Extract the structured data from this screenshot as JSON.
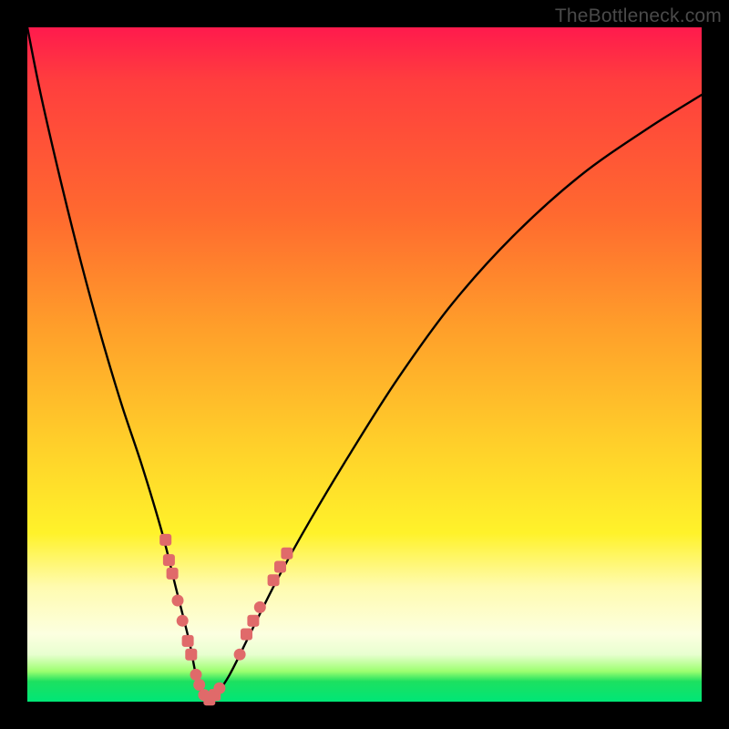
{
  "watermark": "TheBottleneck.com",
  "colors": {
    "frame": "#000000",
    "gradient_top": "#ff1a4d",
    "gradient_mid1": "#ff6a2f",
    "gradient_mid2": "#ffd02a",
    "gradient_mid3": "#fffbb0",
    "gradient_bottom": "#00e676",
    "curve": "#000000",
    "markers": "#e06a6a"
  },
  "chart_data": {
    "type": "line",
    "title": "",
    "xlabel": "",
    "ylabel": "",
    "xlim": [
      0,
      100
    ],
    "ylim": [
      0,
      100
    ],
    "grid": false,
    "legend": false,
    "series": [
      {
        "name": "bottleneck-curve",
        "x": [
          0,
          2,
          5,
          8,
          11,
          14,
          17,
          20,
          22,
          24,
          25,
          26,
          27,
          28,
          30,
          33,
          37,
          42,
          48,
          55,
          63,
          72,
          82,
          92,
          100
        ],
        "values": [
          100,
          90,
          77,
          65,
          54,
          44,
          35,
          25,
          17,
          9,
          4,
          1,
          0,
          1,
          4,
          10,
          18,
          27,
          37,
          48,
          59,
          69,
          78,
          85,
          90
        ]
      }
    ],
    "markers": [
      {
        "x": 20.5,
        "y": 24,
        "shape": "square"
      },
      {
        "x": 21.0,
        "y": 21,
        "shape": "square"
      },
      {
        "x": 21.5,
        "y": 19,
        "shape": "square"
      },
      {
        "x": 22.3,
        "y": 15,
        "shape": "circle"
      },
      {
        "x": 23.0,
        "y": 12,
        "shape": "circle"
      },
      {
        "x": 23.8,
        "y": 9,
        "shape": "square"
      },
      {
        "x": 24.3,
        "y": 7,
        "shape": "square"
      },
      {
        "x": 25.0,
        "y": 4,
        "shape": "circle"
      },
      {
        "x": 25.5,
        "y": 2.5,
        "shape": "circle"
      },
      {
        "x": 26.2,
        "y": 1,
        "shape": "circle"
      },
      {
        "x": 27.0,
        "y": 0.3,
        "shape": "square"
      },
      {
        "x": 27.8,
        "y": 1,
        "shape": "square"
      },
      {
        "x": 28.5,
        "y": 2,
        "shape": "circle"
      },
      {
        "x": 31.5,
        "y": 7,
        "shape": "circle"
      },
      {
        "x": 32.5,
        "y": 10,
        "shape": "square"
      },
      {
        "x": 33.5,
        "y": 12,
        "shape": "square"
      },
      {
        "x": 34.5,
        "y": 14,
        "shape": "circle"
      },
      {
        "x": 36.5,
        "y": 18,
        "shape": "square"
      },
      {
        "x": 37.5,
        "y": 20,
        "shape": "square"
      },
      {
        "x": 38.5,
        "y": 22,
        "shape": "square"
      }
    ]
  }
}
